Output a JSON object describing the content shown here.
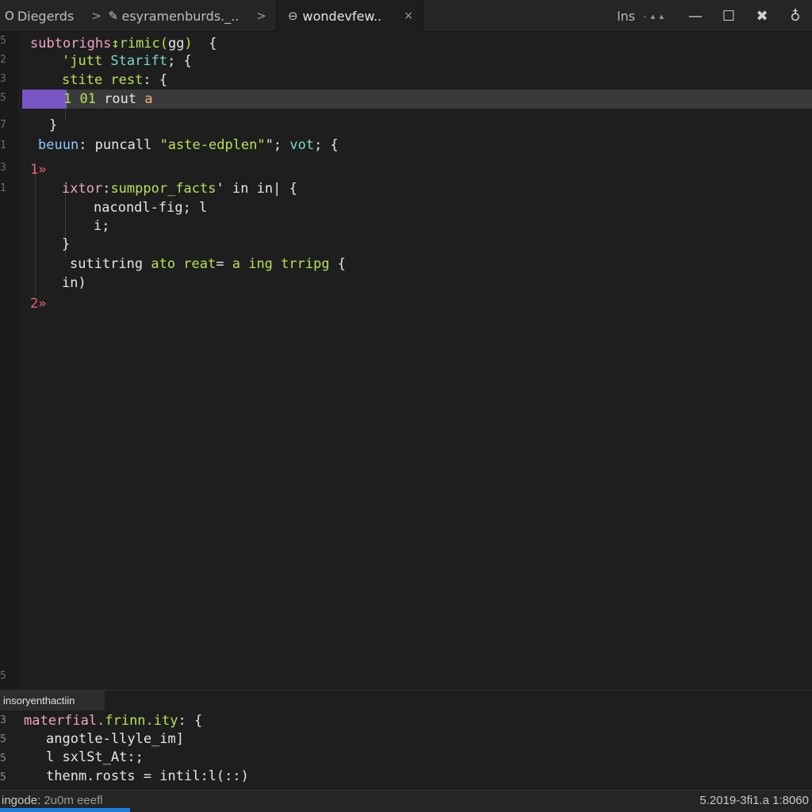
{
  "tabs": [
    {
      "icon": "circle-icon",
      "glyph": "O",
      "label": "Diegerds",
      "separator": ">"
    },
    {
      "icon": "pencil-icon",
      "glyph": "✎",
      "label": "esyramenburds._..",
      "separator": ">"
    },
    {
      "icon": "eye-icon",
      "glyph": "⊖",
      "label": "wondevfew..",
      "close": "×"
    }
  ],
  "titlebar": {
    "mode": "lns",
    "mode_extra": "- ▴ ▴",
    "minimize": "—",
    "maximize": "☐",
    "close": "✖",
    "account": "♁"
  },
  "gutter_numbers": [
    "5",
    "2",
    "3",
    "5",
    "7",
    "1",
    "3",
    "1",
    "5"
  ],
  "editor": {
    "lines": [
      {
        "tokens": [
          {
            "t": "subtorighs",
            "c": "c-pink"
          },
          {
            "t": "↕rimic(",
            "c": "c-green"
          },
          {
            "t": "gg",
            "c": "c-white"
          },
          {
            "t": ")  ",
            "c": "c-green"
          },
          {
            "t": "{",
            "c": "c-white"
          }
        ]
      },
      {
        "tokens": [
          {
            "t": "'jutt ",
            "c": "c-green"
          },
          {
            "t": "Starift",
            "c": "c-teal"
          },
          {
            "t": "; {",
            "c": "c-white"
          }
        ]
      },
      {
        "tokens": [
          {
            "t": "stite rest",
            "c": "c-green"
          },
          {
            "t": ": {",
            "c": "c-white"
          }
        ]
      },
      {
        "tokens": [
          {
            "t": "1 01 ",
            "c": "c-green"
          },
          {
            "t": "rout ",
            "c": "c-white"
          },
          {
            "t": "a",
            "c": "c-orange"
          }
        ]
      },
      {
        "tokens": [
          {
            "t": "}",
            "c": "c-white"
          }
        ]
      },
      {
        "tokens": [
          {
            "t": "beuun",
            "c": "c-blue"
          },
          {
            "t": ": ",
            "c": "c-white"
          },
          {
            "t": "puncall ",
            "c": "c-white"
          },
          {
            "t": "\"aste-edplen\"",
            "c": "c-green"
          },
          {
            "t": "\"; ",
            "c": "c-white"
          },
          {
            "t": "vot",
            "c": "c-teal"
          },
          {
            "t": "; {",
            "c": "c-white"
          }
        ]
      },
      {
        "tokens": [
          {
            "t": "1»",
            "c": "c-red"
          }
        ]
      },
      {
        "tokens": [
          {
            "t": "ixtor",
            "c": "c-pink"
          },
          {
            "t": ":",
            "c": "c-white"
          },
          {
            "t": "sumppor_facts",
            "c": "c-green"
          },
          {
            "t": "' in in| {",
            "c": "c-white"
          }
        ]
      },
      {
        "tokens": [
          {
            "t": "nacondl-fig; l",
            "c": "c-white"
          }
        ]
      },
      {
        "tokens": [
          {
            "t": "i;",
            "c": "c-white"
          }
        ]
      },
      {
        "tokens": [
          {
            "t": "}",
            "c": "c-white"
          }
        ]
      },
      {
        "tokens": [
          {
            "t": "sutitring ",
            "c": "c-white"
          },
          {
            "t": "ato reat",
            "c": "c-green"
          },
          {
            "t": "= ",
            "c": "c-white"
          },
          {
            "t": "a ing trripg",
            "c": "c-green"
          },
          {
            "t": " {",
            "c": "c-white"
          }
        ]
      },
      {
        "tokens": [
          {
            "t": "in)",
            "c": "c-white"
          }
        ]
      },
      {
        "tokens": [
          {
            "t": "2»",
            "c": "c-red"
          }
        ]
      }
    ]
  },
  "panel": {
    "title": "insoryenthactiin",
    "gutter_numbers": [
      "3",
      "5",
      "5",
      "5"
    ],
    "lines": [
      {
        "tokens": [
          {
            "t": "materfial.",
            "c": "c-pink"
          },
          {
            "t": "frinn.ity",
            "c": "c-green"
          },
          {
            "t": ": {",
            "c": "c-white"
          }
        ]
      },
      {
        "tokens": [
          {
            "t": "angotle-llyle_im]",
            "c": "c-white"
          }
        ]
      },
      {
        "tokens": [
          {
            "t": "l sxlSt_At:;",
            "c": "c-white"
          }
        ]
      },
      {
        "tokens": [
          {
            "t": "thenm.rosts = intil:l(::)",
            "c": "c-white"
          }
        ]
      }
    ]
  },
  "status": {
    "left_label": "ingode:",
    "left_value": "2u0m eeefl",
    "right": "5.2019-3fi1.a 1:8060"
  },
  "progress_fraction": 0.16
}
